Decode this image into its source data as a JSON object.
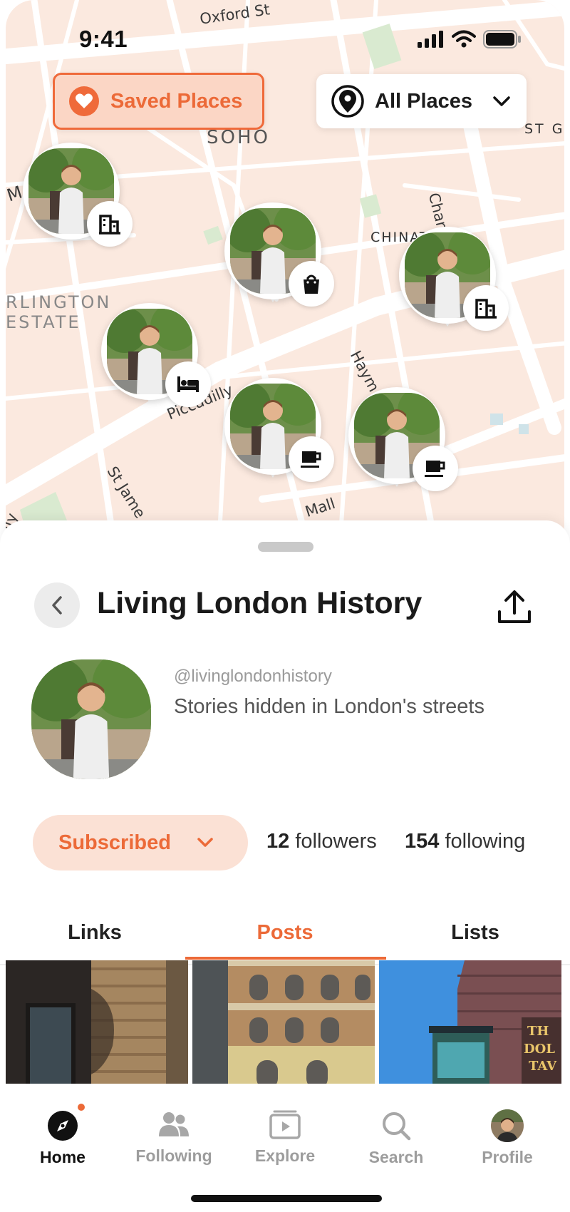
{
  "status_bar": {
    "time": "9:41"
  },
  "map": {
    "labels": {
      "oxford_st": "Oxford St",
      "soho": "SOHO",
      "st_gi": "ST GI",
      "charing_cross_rd": "Charing Cross Rd",
      "chinat": "CHINAT",
      "m": "M",
      "rlington": "RLINGTON",
      "estate": "ESTATE",
      "haym": "Haym",
      "piccadilly": "Piccadilly",
      "st_james": "St Jame",
      "mall": "Mall",
      "lly": "lly"
    },
    "saved_places_label": "Saved Places",
    "all_places_label": "All Places",
    "pins": [
      {
        "category": "building-icon"
      },
      {
        "category": "shopping-bag-icon"
      },
      {
        "category": "building-icon"
      },
      {
        "category": "bed-icon"
      },
      {
        "category": "coffee-cup-icon"
      },
      {
        "category": "coffee-cup-icon"
      }
    ]
  },
  "profile": {
    "title": "Living London History",
    "handle": "@livinglondonhistory",
    "bio": "Stories hidden in London's streets",
    "subscribed_label": "Subscribed",
    "followers_count": "12",
    "followers_label": "followers",
    "following_count": "154",
    "following_label": "following"
  },
  "tabs": [
    {
      "label": "Links",
      "active": false
    },
    {
      "label": "Posts",
      "active": true
    },
    {
      "label": "Lists",
      "active": false
    }
  ],
  "nav": [
    {
      "label": "Home",
      "icon": "compass-icon",
      "active": true,
      "has_dot": true
    },
    {
      "label": "Following",
      "icon": "people-icon",
      "active": false
    },
    {
      "label": "Explore",
      "icon": "play-icon",
      "active": false
    },
    {
      "label": "Search",
      "icon": "search-icon",
      "active": false
    },
    {
      "label": "Profile",
      "icon": "avatar",
      "active": false
    }
  ],
  "colors": {
    "accent": "#ec6a38",
    "accent_light": "#fbe1d5",
    "map_bg": "#fbe9df"
  }
}
